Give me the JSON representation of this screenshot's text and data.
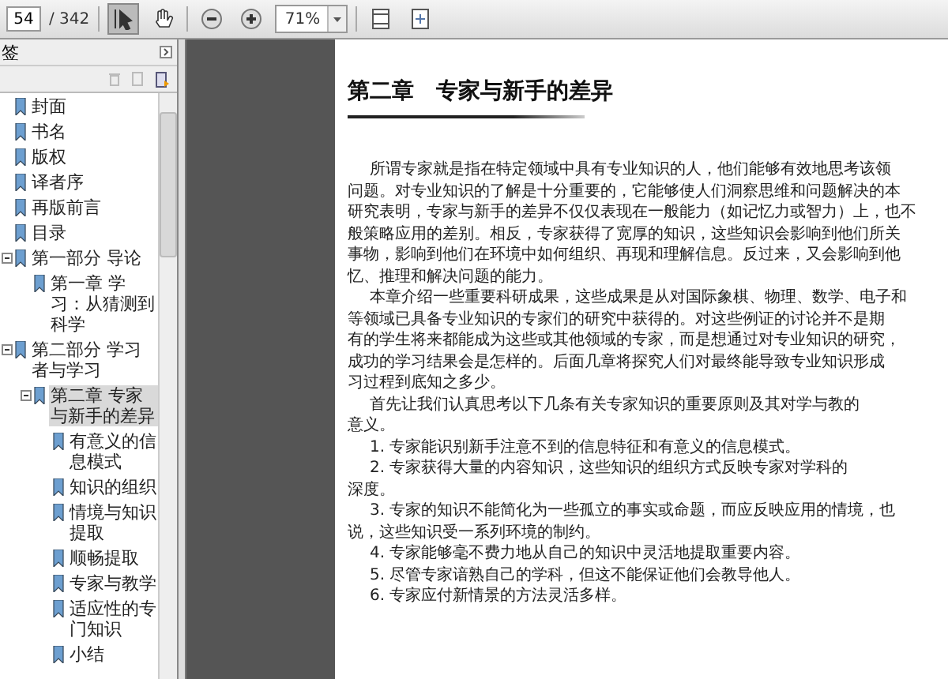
{
  "toolbar": {
    "page": "54",
    "page_count": "/ 342",
    "zoom": "71%",
    "tools": [
      {
        "kind": "select",
        "selected": true
      },
      {
        "kind": "hand",
        "selected": false
      }
    ]
  },
  "sidebar": {
    "title": "签",
    "bookmarks": [
      {
        "label": "封面"
      },
      {
        "label": "书名"
      },
      {
        "label": "版权"
      },
      {
        "label": "译者序"
      },
      {
        "label": "再版前言"
      },
      {
        "label": "目录"
      },
      {
        "label": "第一部分 导论",
        "expanded": true,
        "children": [
          {
            "label": "第一章 学习：从猜测到科学"
          }
        ]
      },
      {
        "label": "第二部分 学习者与学习",
        "expanded": true,
        "children": [
          {
            "label": "第二章 专家与新手的差异",
            "selected": true,
            "expanded": true,
            "children": [
              {
                "label": "有意义的信息模式"
              },
              {
                "label": "知识的组织"
              },
              {
                "label": "情境与知识提取"
              },
              {
                "label": "顺畅提取"
              },
              {
                "label": "专家与教学"
              },
              {
                "label": "适应性的专门知识"
              },
              {
                "label": "小结"
              }
            ]
          }
        ]
      }
    ]
  },
  "document": {
    "heading": "第二章　专家与新手的差异",
    "lines": [
      {
        "kind": "first",
        "text": "所谓专家就是指在特定领域中具有专业知识的人，他们能够有效地思考该领"
      },
      {
        "kind": "cont",
        "text": "问题。对专业知识的了解是十分重要的，它能够使人们洞察思维和问题解决的本"
      },
      {
        "kind": "cont",
        "text": "研究表明，专家与新手的差异不仅仅表现在一般能力（如记忆力或智力）上，也不"
      },
      {
        "kind": "cont",
        "text": "般策略应用的差别。相反，专家获得了宽厚的知识，这些知识会影响到他们所关"
      },
      {
        "kind": "cont",
        "text": "事物，影响到他们在环境中如何组织、再现和理解信息。反过来，又会影响到他"
      },
      {
        "kind": "cont",
        "text": "忆、推理和解决问题的能力。"
      },
      {
        "kind": "first",
        "text": "本章介绍一些重要科研成果，这些成果是从对国际象棋、物理、数学、电子和"
      },
      {
        "kind": "cont",
        "text": "等领域已具备专业知识的专家们的研究中获得的。对这些例证的讨论并不是期"
      },
      {
        "kind": "cont",
        "text": "有的学生将来都能成为这些或其他领域的专家，而是想通过对专业知识的研究，"
      },
      {
        "kind": "cont",
        "text": "成功的学习结果会是怎样的。后面几章将探究人们对最终能导致专业知识形成"
      },
      {
        "kind": "cont",
        "text": "习过程到底知之多少。"
      },
      {
        "kind": "first",
        "text": "首先让我们认真思考以下几条有关专家知识的重要原则及其对学与教的"
      },
      {
        "kind": "cont",
        "text": "意义。"
      },
      {
        "kind": "first",
        "text": "1. 专家能识别新手注意不到的信息特征和有意义的信息模式。"
      },
      {
        "kind": "first",
        "text": "2. 专家获得大量的内容知识，这些知识的组织方式反映专家对学科的"
      },
      {
        "kind": "cont",
        "text": "深度。"
      },
      {
        "kind": "first",
        "text": "3. 专家的知识不能简化为一些孤立的事实或命题，而应反映应用的情境，也"
      },
      {
        "kind": "cont",
        "text": "说，这些知识受一系列环境的制约。"
      },
      {
        "kind": "first",
        "text": "4. 专家能够毫不费力地从自己的知识中灵活地提取重要内容。"
      },
      {
        "kind": "first",
        "text": "5. 尽管专家谙熟自己的学科，但这不能保证他们会教导他人。"
      },
      {
        "kind": "first",
        "text": "6. 专家应付新情景的方法灵活多样。"
      }
    ]
  }
}
